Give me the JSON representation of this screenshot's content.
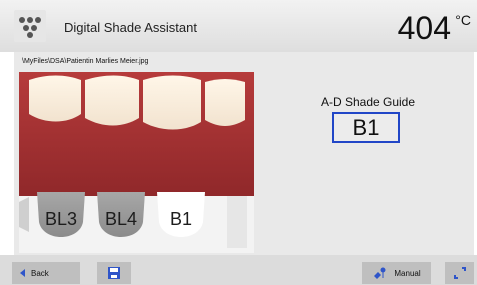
{
  "header": {
    "title": "Digital Shade Assistant",
    "temperature": "404",
    "temperature_unit": "°C",
    "app_icon": "teeth-grid-icon"
  },
  "main": {
    "file_path": "\\MyFiles\\DSA\\Patientin Marlies Meier.jpg",
    "photo": {
      "tab_labels": [
        "BL3",
        "BL4",
        "B1"
      ]
    },
    "shade_guide_label": "A-D Shade Guide",
    "shade_result": "B1"
  },
  "footer": {
    "back_label": "Back",
    "save_icon": "save-icon",
    "manual_label": "Manual",
    "manual_icon": "manual-icon",
    "expand_icon": "expand-icon"
  },
  "colors": {
    "highlight_border": "#2146c7",
    "button_bg": "#bfbfbf",
    "header_bg": "#e6e6e6",
    "content_bg": "#e9e9e9",
    "accent_blue": "#2f55c9"
  }
}
